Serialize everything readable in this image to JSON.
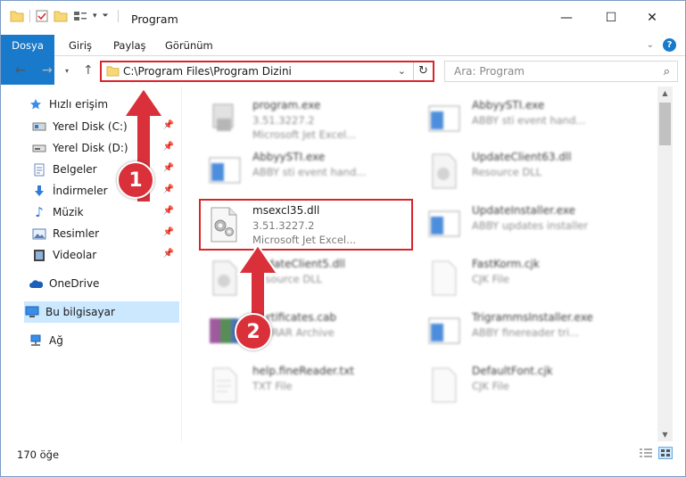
{
  "window": {
    "title": "Program",
    "controls": {
      "minimize": "—",
      "maximize": "☐",
      "close": "✕"
    }
  },
  "ribbon": {
    "tabs": [
      "Dosya",
      "Giriş",
      "Paylaş",
      "Görünüm"
    ]
  },
  "address": {
    "path": "C:\\Program Files\\Program Dizini",
    "search_placeholder": "Ara: Program"
  },
  "sidebar": {
    "items": [
      {
        "label": "Hızlı erişim",
        "icon": "star-icon",
        "pinned": false
      },
      {
        "label": "Yerel Disk (C:)",
        "icon": "drive-icon",
        "pinned": true
      },
      {
        "label": "Yerel Disk (D:)",
        "icon": "drive-icon",
        "pinned": true
      },
      {
        "label": "Belgeler",
        "icon": "document-icon",
        "pinned": true
      },
      {
        "label": "İndirmeler",
        "icon": "download-icon",
        "pinned": true
      },
      {
        "label": "Müzik",
        "icon": "music-icon",
        "pinned": true
      },
      {
        "label": "Resimler",
        "icon": "pictures-icon",
        "pinned": true
      },
      {
        "label": "Videolar",
        "icon": "video-icon",
        "pinned": true
      },
      {
        "label": "OneDrive",
        "icon": "cloud-icon",
        "pinned": false
      },
      {
        "label": "Bu bilgisayar",
        "icon": "computer-icon",
        "pinned": false
      },
      {
        "label": "Ağ",
        "icon": "network-icon",
        "pinned": false
      }
    ]
  },
  "files": [
    {
      "name": "program.exe",
      "line1": "3.51.3227.2",
      "line2": "Microsoft Jet Excel...",
      "icon": "exe-icon",
      "blurred": true
    },
    {
      "name": "AbbyySTI.exe",
      "line1": "ABBY sti event hand...",
      "line2": "",
      "icon": "window-app-icon",
      "blurred": true
    },
    {
      "name": "AbbyySTI.exe",
      "line1": "ABBY sti event hand...",
      "line2": "",
      "icon": "window-app-icon",
      "blurred": true
    },
    {
      "name": "UpdateClient63.dll",
      "line1": "Resource DLL",
      "line2": "",
      "icon": "dll-icon",
      "blurred": true
    },
    {
      "name": "msexcl35.dll",
      "line1": "3.51.3227.2",
      "line2": "Microsoft Jet Excel...",
      "icon": "dll-gear-icon",
      "blurred": false
    },
    {
      "name": "UpdateInstaller.exe",
      "line1": "ABBY updates installer",
      "line2": "",
      "icon": "window-app-icon",
      "blurred": true
    },
    {
      "name": "UpdateClient5.dll",
      "line1": "Resource DLL",
      "line2": "",
      "icon": "dll-icon",
      "blurred": true
    },
    {
      "name": "FastKorm.cjk",
      "line1": "CJK File",
      "line2": "",
      "icon": "blank-file-icon",
      "blurred": true
    },
    {
      "name": "Certificates.cab",
      "line1": "WinRAR Archive",
      "line2": "",
      "icon": "archive-icon",
      "blurred": true
    },
    {
      "name": "TrigrammsInstaller.exe",
      "line1": "ABBY finereader tri...",
      "line2": "",
      "icon": "window-app-icon",
      "blurred": true
    },
    {
      "name": "help.fineReader.txt",
      "line1": "TXT File",
      "line2": "",
      "icon": "text-file-icon",
      "blurred": true
    },
    {
      "name": "DefaultFont.cjk",
      "line1": "CJK File",
      "line2": "",
      "icon": "blank-file-icon",
      "blurred": true
    }
  ],
  "status": {
    "count": "170 öğe"
  },
  "annotations": {
    "badge1": "1",
    "badge2": "2"
  },
  "colors": {
    "accent": "#1979ca",
    "highlight": "#d9252a",
    "badge": "#d9303a",
    "selected": "#cce8ff"
  }
}
